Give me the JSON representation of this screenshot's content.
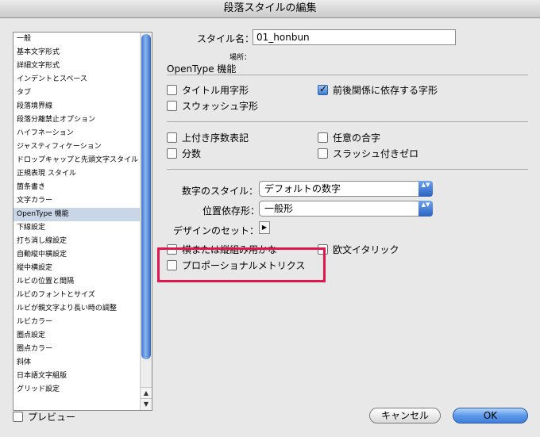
{
  "window": {
    "title": "段落スタイルの編集"
  },
  "sidebar": {
    "items": [
      {
        "label": "一般"
      },
      {
        "label": "基本文字形式"
      },
      {
        "label": "詳細文字形式"
      },
      {
        "label": "インデントとスペース"
      },
      {
        "label": "タブ"
      },
      {
        "label": "段落境界線"
      },
      {
        "label": "段落分離禁止オプション"
      },
      {
        "label": "ハイフネーション"
      },
      {
        "label": "ジャスティフィケーション"
      },
      {
        "label": "ドロップキャップと先頭文字スタイル"
      },
      {
        "label": "正規表現 スタイル"
      },
      {
        "label": "箇条書き"
      },
      {
        "label": "文字カラー"
      },
      {
        "label": "OpenType 機能",
        "selected": true
      },
      {
        "label": "下線設定"
      },
      {
        "label": "打ち消し線設定"
      },
      {
        "label": "自動縦中横設定"
      },
      {
        "label": "縦中横設定"
      },
      {
        "label": "ルビの位置と間隔"
      },
      {
        "label": "ルビのフォントとサイズ"
      },
      {
        "label": "ルビが親文字より長い時の調整"
      },
      {
        "label": "ルビカラー"
      },
      {
        "label": "圏点設定"
      },
      {
        "label": "圏点カラー"
      },
      {
        "label": "斜体"
      },
      {
        "label": "日本語文字組版"
      },
      {
        "label": "グリッド設定"
      }
    ]
  },
  "form": {
    "style_name_label": "スタイル名：",
    "style_name_value": "01_honbun",
    "location_label": "場所：",
    "section_title": "OpenType 機能",
    "checkboxes": {
      "titling": {
        "label": "タイトル用字形",
        "checked": false
      },
      "contextual": {
        "label": "前後関係に依存する字形",
        "checked": true
      },
      "swash": {
        "label": "スウォッシュ字形",
        "checked": false
      },
      "ordinal": {
        "label": "上付き序数表記",
        "checked": false
      },
      "ligature": {
        "label": "任意の合字",
        "checked": false
      },
      "fraction": {
        "label": "分数",
        "checked": false
      },
      "slashed_zero": {
        "label": "スラッシュ付きゼロ",
        "checked": false
      },
      "vertical_alt": {
        "label": "横または縦組み用かな",
        "checked": false
      },
      "roman_italic": {
        "label": "欧文イタリック",
        "checked": false
      },
      "proportional": {
        "label": "プロポーショナルメトリクス",
        "checked": false
      }
    },
    "figure_style_label": "数字のスタイル：",
    "figure_style_value": "デフォルトの数字",
    "positional_label": "位置依存形：",
    "positional_value": "一般形",
    "stylistic_set_label": "デザインのセット：",
    "stepper_glyph": "▲▼",
    "triangle_glyph": "▶"
  },
  "footer": {
    "preview_label": "プレビュー",
    "cancel_label": "キャンセル",
    "ok_label": "OK"
  },
  "colors": {
    "highlight_border": "#e3154d",
    "selected_row": "#c9d6e8",
    "accent": "#3f7fd9"
  }
}
